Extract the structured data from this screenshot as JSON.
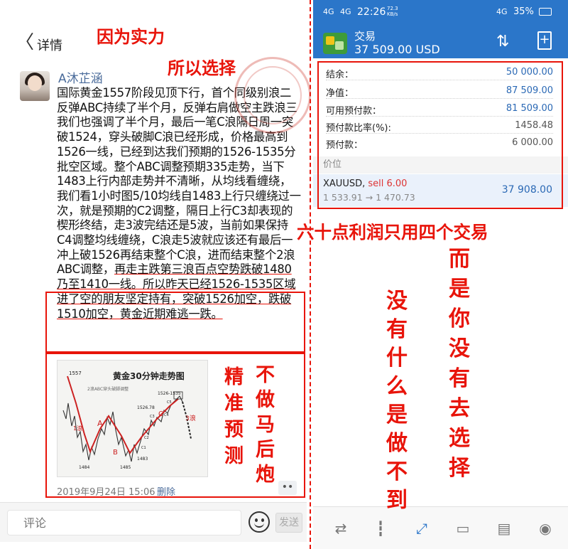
{
  "left": {
    "header": {
      "back_glyph": "〈",
      "title": "详情"
    },
    "post": {
      "username": "A沐芷涵",
      "text_before": "国际黄金1557阶段见顶下行，首个同级别浪二反弹ABC持续了半个月，反弹右肩做空主跌浪三我们也强调了半个月，最后一笔C浪隔日周一突破1524，穿头破脚C浪已经形成，价格最高到1526一线，已经到达我们预期的1526-1535分批空区域。整个ABC调整预期335走势，当下1483上行内部走势并不清晰，从均线看缠绕，我们看1小时图5/10均线自1483上行只缠绕过一次，就是预期的C2调整，隔日上行C3却表现的楔形终结，走3波完结还是5波，当前如果保持C4调整均线缠绕，C浪走5波就应该还有最后一冲上破1526再结束整个C浪，进而结束整个2浪ABC调整，",
      "text_highlight": "再走主跌第三浪百点空势跌破1480乃至1410一线。所以昨天已经1526-1535区域进了空的朋友坚定持有，突破1526加空，跌破1510加空，黄金近期难逃一跌。",
      "date": "2019年9月24日 15:06",
      "delete_label": "删除",
      "more_label": "••"
    },
    "chart_thumb": {
      "title": "黄金30分钟走势图",
      "subtitle": "2浪ABC穿头破脚调整",
      "labels": {
        "p1557": "1557",
        "p1526_1535": "1526-1535",
        "p1526_78": "1526.78",
        "A": "A",
        "B": "B",
        "C": "C",
        "wave1": "1浪",
        "wave3": "3浪",
        "p1484": "1484",
        "p1485": "1485",
        "p1483": "1483",
        "C1": "C1",
        "C2": "C2",
        "C3": "C3",
        "C4": "C4",
        "C5": "C5"
      }
    },
    "comment": {
      "placeholder": "评论",
      "send_label": "发送"
    }
  },
  "right": {
    "status_bar": {
      "net": "4G",
      "time": "22:26",
      "speed": "72.3 KB/s",
      "battery": "35%"
    },
    "app_bar": {
      "title": "交易",
      "balance": "37 509.00 USD",
      "sort_glyph": "⇅",
      "new_glyph": "+"
    },
    "account": [
      {
        "label": "结余：",
        "value": "50 000.00"
      },
      {
        "label": "净值：",
        "value": "87 509.00"
      },
      {
        "label": "可用预付款：",
        "value": "81 509.00"
      },
      {
        "label": "预付款比率(%):",
        "value": "1458.48"
      },
      {
        "label": "预付款：",
        "value": "6 000.00"
      }
    ],
    "price_header": "价位",
    "position": {
      "symbol": "XAUUSD,",
      "direction": "sell 6.00",
      "prices": "1 533.91 → 1 470.73",
      "profit": "37 908.00"
    },
    "bottom_nav": [
      "quotes-icon",
      "chart-icon",
      "trade-icon",
      "history-icon",
      "news-icon",
      "chat-icon"
    ]
  },
  "captions": {
    "because_strength": "因为实力",
    "so_choose": "所以选择",
    "sixty_points": "六十点利润只用四个交易",
    "col1": "而是你没有去选择",
    "col2": "没有什么是做不到",
    "col3": "不做马后炮",
    "col4": "精准预测"
  },
  "colors": {
    "accent_red": "#e8140a",
    "app_blue": "#2b76c9",
    "link_blue": "#2b69b5"
  }
}
